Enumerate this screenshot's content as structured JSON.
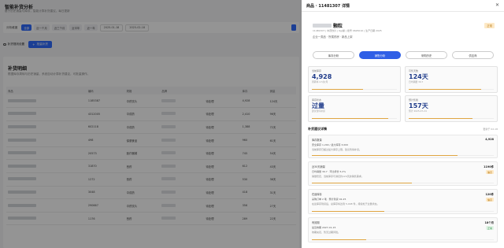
{
  "left": {
    "title": "智能补货分析",
    "subtitle": "基于历史销量与库存，智能计算补货建议，每日更新",
    "filter_label": "分析维度",
    "chips": [
      "全部",
      "近一个月",
      "近三个月",
      "近半年",
      "近一年"
    ],
    "date_from": "2025-01-18",
    "date_to": "2025-02-18",
    "actions": {
      "settings": "补货规则设置",
      "primary": "批量补货"
    },
    "card_title": "补货明细",
    "card_subtitle": "根据库存周转与历史销量，系统自动计算补货建议，可批量操作。",
    "columns": [
      "商品",
      "编码",
      "规格",
      "品牌",
      "",
      "",
      "库存",
      "销量"
    ],
    "rows": [
      {
        "code": "1185387",
        "spec": "中药饮片",
        "brand": "",
        "status": "待处理",
        "stock": "4,928",
        "sales": "124天"
      },
      {
        "code": "4312005",
        "spec": "中成药",
        "brand": "",
        "status": "待处理",
        "stock": "2,410",
        "sales": "96天"
      },
      {
        "code": "602118",
        "spec": "中成药",
        "brand": "",
        "status": "待处理",
        "stock": "1,388",
        "sales": "72天"
      },
      {
        "code": "498",
        "spec": "保健食品",
        "brand": "",
        "status": "待处理",
        "stock": "960",
        "sales": "61天"
      },
      {
        "code": "20573",
        "spec": "医疗器械",
        "brand": "",
        "status": "待处理",
        "stock": "745",
        "sales": "54天"
      },
      {
        "code": "31870",
        "spec": "西药",
        "brand": "",
        "status": "待处理",
        "stock": "612",
        "sales": "43天"
      },
      {
        "code": "1272",
        "spec": "西药",
        "brand": "",
        "status": "待处理",
        "stock": "530",
        "sales": "38天"
      },
      {
        "code": "3048",
        "spec": "中成药",
        "brand": "",
        "status": "待处理",
        "stock": "418",
        "sales": "31天"
      },
      {
        "code": "290667",
        "spec": "中药饮片",
        "brand": "",
        "status": "待处理",
        "stock": "356",
        "sales": "27天"
      },
      {
        "code": "1176",
        "spec": "西药",
        "brand": "",
        "status": "待处理",
        "stock": "289",
        "sales": "22天"
      }
    ]
  },
  "drawer": {
    "header": "商品 · 11481307 详情",
    "close": "✕",
    "product_name": "颗粒",
    "product_meta": "11481307 | 中药饮片 | 6g/袋 | 批号 0625010 | 生产日期 2025",
    "product_tags": "企业一类品 · 所属药房 · 新品上架",
    "badge": "正常",
    "tabs": [
      "库存分析",
      "销售分析",
      "采购历史",
      "供应商"
    ],
    "active_tab": 1,
    "kpis": [
      {
        "label": "当前库存",
        "value": "4,928",
        "note": "周转率 4.5次/月",
        "fill": 0.6
      },
      {
        "label": "可售天数",
        "value": "124天",
        "note": "日均销量 39.7",
        "fill": 0.85
      },
      {
        "label": "库存状态",
        "value": "过量",
        "note": "建议暂停补货",
        "fill": 0.9
      },
      {
        "label": "预计售罄",
        "value": "157天",
        "note": "预计 2025-07-24",
        "fill": 0.75
      }
    ],
    "section_title": "补货建议详情",
    "section_note": "更新于 02-18",
    "items": [
      {
        "title": "库存数量",
        "value": "4,928",
        "line": "安全库存 1,200 / 最大库存 3,000",
        "desc": "当前库存已超过最大库存上限，建议暂停补货。",
        "tag": "",
        "fill": 0.8
      },
      {
        "title": "近30天销量",
        "value": "1190件",
        "line": "日均销量 39.7 · 环比增长 5.2%",
        "desc": "销量稳定，当前库存可满足约124天的销售需求。",
        "tag": "偏高",
        "tagtype": "warn",
        "fill": 0.55
      },
      {
        "title": "在途库存",
        "value": "120件",
        "line": "采购订单 2 笔 · 预计到货 02-25",
        "desc": "在途库存到货后，总库存将达到 5,048 件，持续处于过量状态。",
        "tag": "偏高",
        "tagtype": "warn",
        "fill": 0.4
      },
      {
        "title": "有效期",
        "value": "18个月",
        "line": "最近效期 2027-01-15",
        "desc": "效期充足，暂无过期风险。",
        "tag": "正常",
        "tagtype": "ok",
        "fill": 0.3
      }
    ]
  }
}
